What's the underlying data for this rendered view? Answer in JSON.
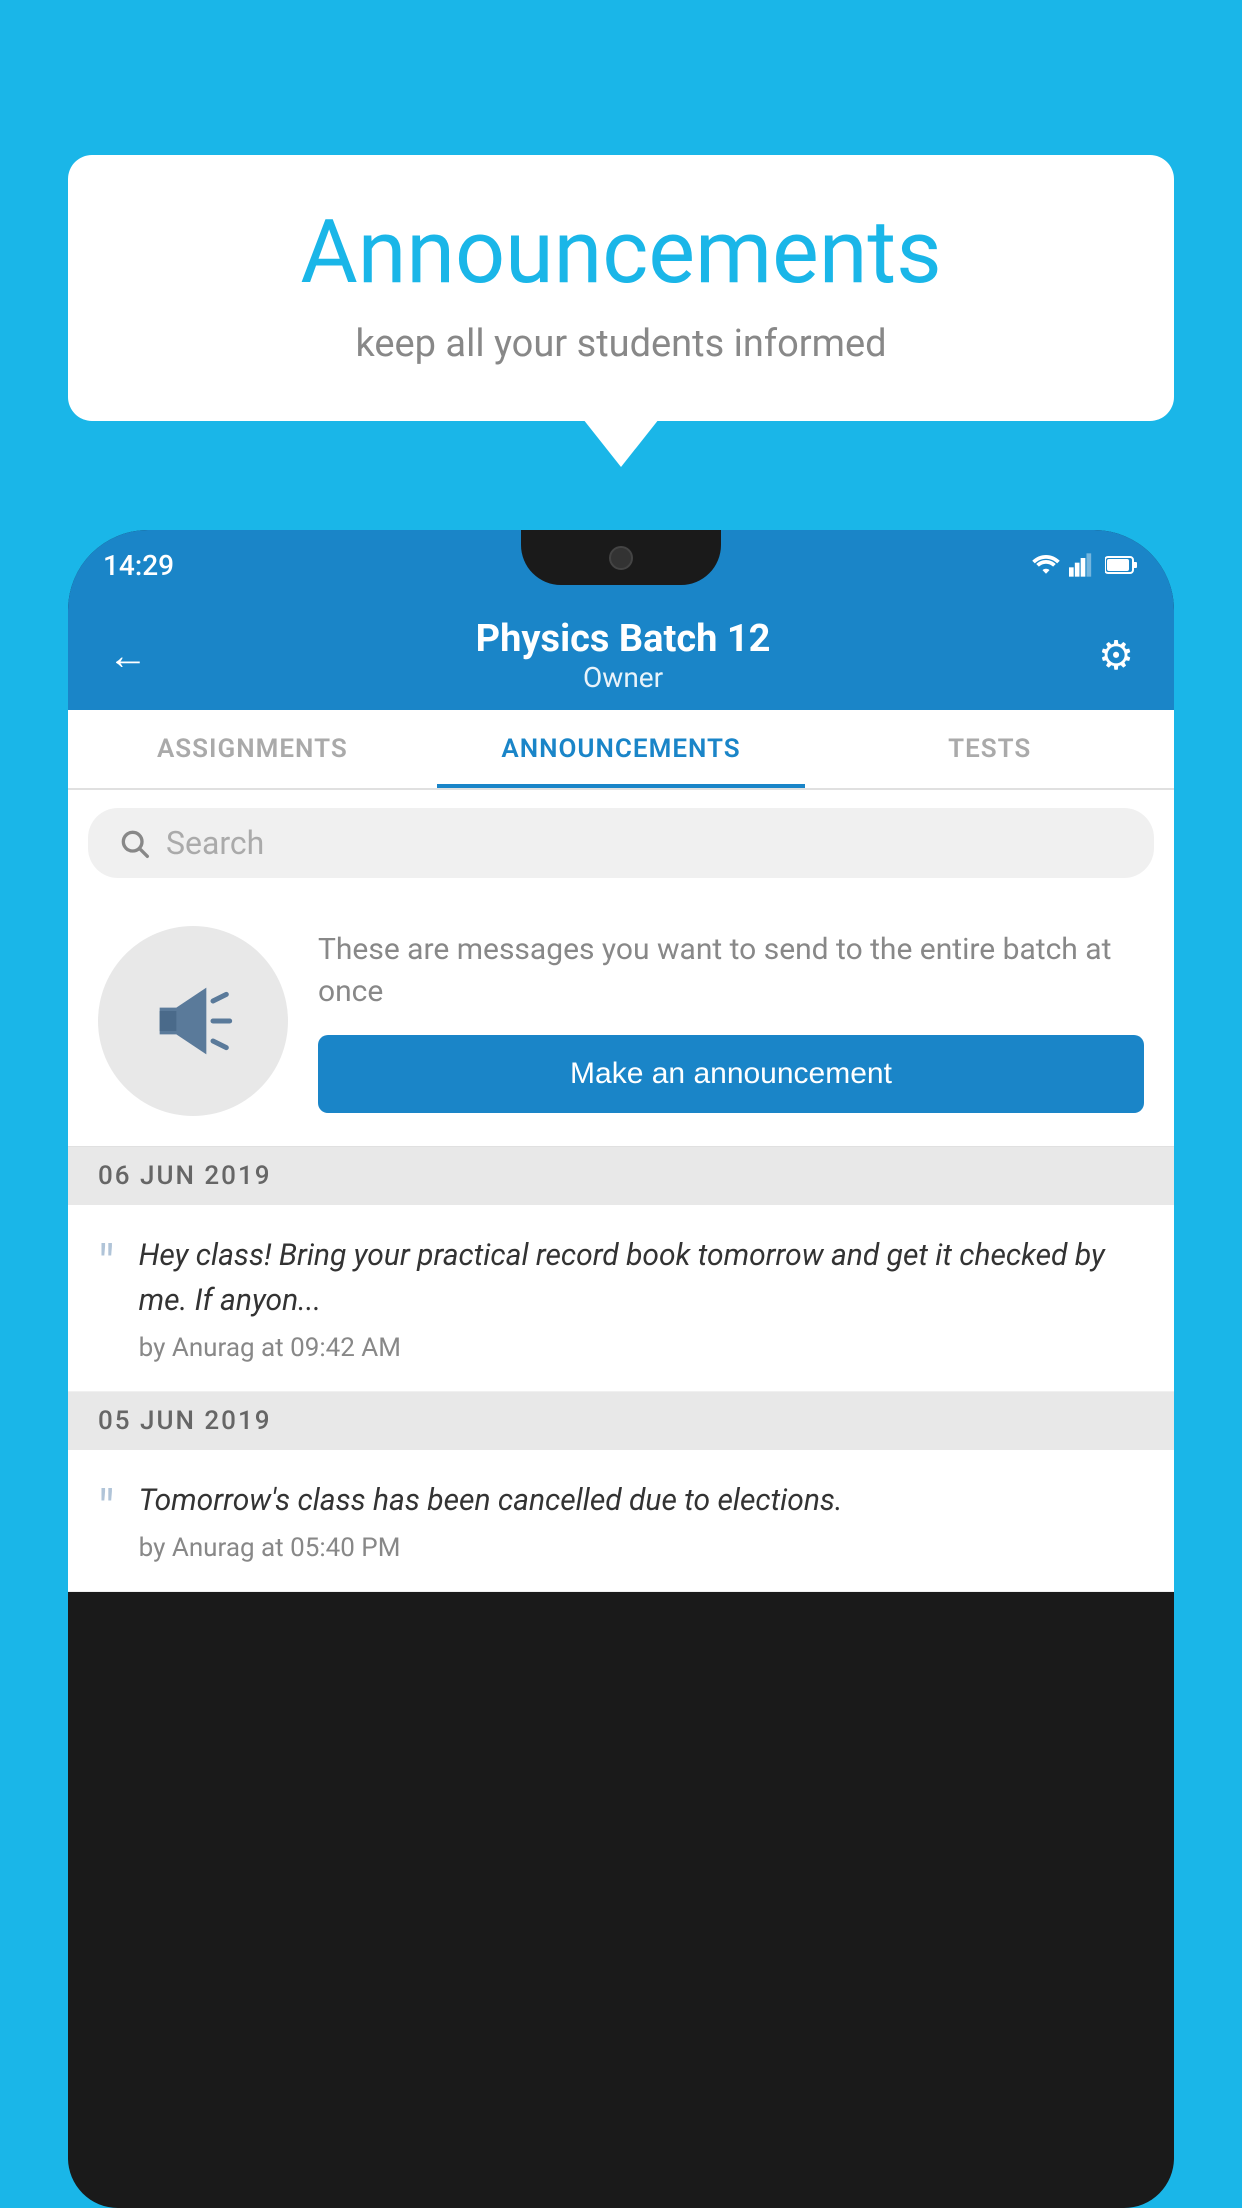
{
  "bubble": {
    "title": "Announcements",
    "subtitle": "keep all your students informed"
  },
  "phone": {
    "statusBar": {
      "time": "14:29",
      "icons": [
        "wifi",
        "signal",
        "battery"
      ]
    },
    "header": {
      "title": "Physics Batch 12",
      "subtitle": "Owner",
      "backLabel": "←",
      "gearLabel": "⚙"
    },
    "tabs": [
      {
        "label": "ASSIGNMENTS",
        "active": false
      },
      {
        "label": "ANNOUNCEMENTS",
        "active": true
      },
      {
        "label": "TESTS",
        "active": false
      }
    ],
    "search": {
      "placeholder": "Search"
    },
    "promo": {
      "description": "These are messages you want to send to the entire batch at once",
      "buttonLabel": "Make an announcement"
    },
    "announcements": [
      {
        "date": "06  JUN  2019",
        "text": "Hey class! Bring your practical record book tomorrow and get it checked by me. If anyon...",
        "meta": "by Anurag at 09:42 AM"
      },
      {
        "date": "05  JUN  2019",
        "text": "Tomorrow's class has been cancelled due to elections.",
        "meta": "by Anurag at 05:40 PM"
      }
    ]
  }
}
